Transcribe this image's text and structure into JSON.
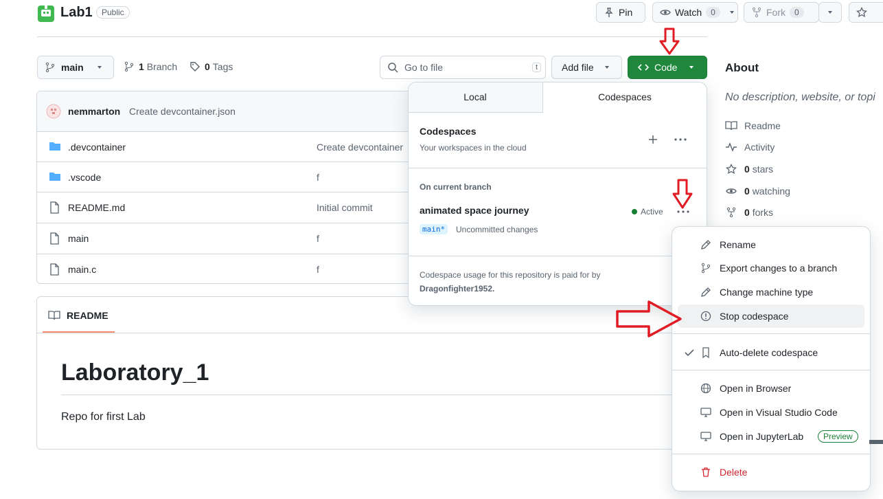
{
  "repo": {
    "name": "Lab1",
    "visibility": "Public"
  },
  "header_actions": {
    "pin": "Pin",
    "watch": "Watch",
    "watch_count": "0",
    "fork": "Fork",
    "fork_count": "0"
  },
  "toolbar": {
    "branch": "main",
    "branches_count": "1",
    "branches_label": "Branch",
    "tags_count": "0",
    "tags_label": "Tags",
    "go_to_file_placeholder": "Go to file",
    "go_to_file_shortcut": "t",
    "add_file": "Add file",
    "code": "Code"
  },
  "commit": {
    "author": "nemmarton",
    "message": "Create devcontainer.json"
  },
  "files": [
    {
      "name": ".devcontainer",
      "type": "folder",
      "message": "Create devcontainer"
    },
    {
      "name": ".vscode",
      "type": "folder",
      "message": "f"
    },
    {
      "name": "README.md",
      "type": "file",
      "message": "Initial commit"
    },
    {
      "name": "main",
      "type": "file",
      "message": "f"
    },
    {
      "name": "main.c",
      "type": "file",
      "message": "f"
    }
  ],
  "readme": {
    "tab_label": "README",
    "heading": "Laboratory_1",
    "body": "Repo for first Lab"
  },
  "code_panel": {
    "tabs": [
      "Local",
      "Codespaces"
    ],
    "active_tab": "Codespaces",
    "title": "Codespaces",
    "subtitle": "Your workspaces in the cloud",
    "section_label": "On current branch",
    "codespace_name": "animated space journey",
    "status": "Active",
    "branch_badge": "main*",
    "changes": "Uncommitted changes",
    "billing_text": "Codespace usage for this repository is paid for by",
    "billing_owner": "Dragonfighter1952."
  },
  "context_menu": {
    "rename": "Rename",
    "export": "Export changes to a branch",
    "change_machine": "Change machine type",
    "stop": "Stop codespace",
    "auto_delete": "Auto-delete codespace",
    "open_browser": "Open in Browser",
    "open_vscode": "Open in Visual Studio Code",
    "open_jupyter": "Open in JupyterLab",
    "preview_badge": "Preview",
    "delete": "Delete"
  },
  "about": {
    "title": "About",
    "description": "No description, website, or topi",
    "readme": "Readme",
    "activity": "Activity",
    "stars_count": "0",
    "stars_label": "stars",
    "watching_count": "0",
    "watching_label": "watching",
    "forks_count": "0",
    "forks_label": "forks"
  },
  "colors": {
    "code_button": "#1f883d",
    "accent_blue": "#0969da",
    "annotation_red": "#e01b24",
    "danger": "#d1242f",
    "folder": "#54aeff"
  }
}
